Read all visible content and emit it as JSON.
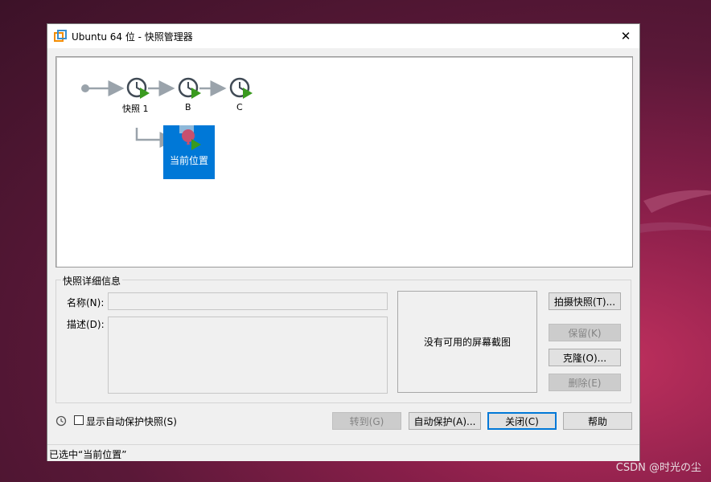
{
  "window": {
    "title": "Ubuntu 64 位 - 快照管理器"
  },
  "tree": {
    "snapshots": [
      {
        "label": "快照 1"
      },
      {
        "label": "B"
      },
      {
        "label": "C"
      }
    ],
    "current_label": "当前位置"
  },
  "details": {
    "group_title": "快照详细信息",
    "name_label": "名称(N):",
    "name_value": "",
    "desc_label": "描述(D):",
    "desc_value": "",
    "screenshot_text": "没有可用的屏幕截图"
  },
  "buttons": {
    "take": "拍摄快照(T)...",
    "keep": "保留(K)",
    "clone": "克隆(O)...",
    "delete": "删除(E)",
    "goto": "转到(G)",
    "autoprotect": "自动保护(A)...",
    "close": "关闭(C)",
    "help": "帮助"
  },
  "options": {
    "show_auto_label": "显示自动保护快照(S)"
  },
  "status": {
    "text": "已选中“当前位置”"
  },
  "watermark": "CSDN @时光の尘",
  "colors": {
    "selection": "#0078d7",
    "play": "#3a9a1f",
    "clock": "#404a55",
    "arrow": "#9aa3ab"
  }
}
